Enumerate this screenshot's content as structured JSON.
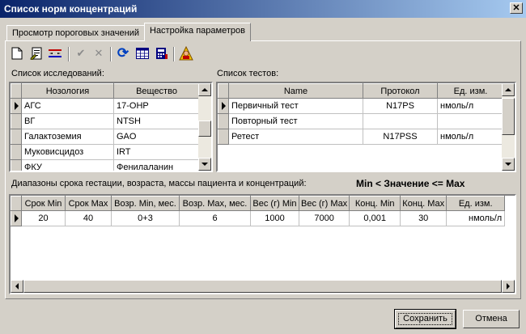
{
  "window": {
    "title": "Список норм концентраций",
    "close_glyph": "✕"
  },
  "tabs": [
    {
      "label": "Просмотр пороговых значений"
    },
    {
      "label": "Настройка параметров"
    }
  ],
  "toolbar": {
    "icons": [
      "new-document-icon",
      "edit-document-icon",
      "move-rows-icon",
      "accept-check-icon",
      "cancel-cross-icon",
      "refresh-icon",
      "grid-table-icon",
      "calculator-icon",
      "user-settings-icon"
    ],
    "check_glyph": "✔",
    "cross_glyph": "✕",
    "refresh_glyph": "⟳"
  },
  "studies": {
    "label": "Список исследований:",
    "columns": [
      "Нозология",
      "Вещество"
    ],
    "rows": [
      [
        "АГС",
        "17-OHP"
      ],
      [
        "ВГ",
        "NTSH"
      ],
      [
        "Галактоземия",
        "GAO"
      ],
      [
        "Муковисцидоз",
        "IRT"
      ],
      [
        "ФКУ",
        "Фенилаланин"
      ]
    ]
  },
  "tests": {
    "label": "Список тестов:",
    "columns": [
      "Name",
      "Протокол",
      "Ед. изм."
    ],
    "rows": [
      [
        "Первичный тест",
        "N17PS",
        "нмоль/л"
      ],
      [
        "Повторный тест",
        "",
        ""
      ],
      [
        "Ретест",
        "N17PSS",
        "нмоль/л"
      ]
    ]
  },
  "ranges": {
    "label": "Диапазоны срока гестации, возраста, массы пациента и концентраций:",
    "formula": "Min < Значение <= Max",
    "columns": [
      "Срок Min",
      "Срок Max",
      "Возр. Min, мес.",
      "Возр. Max, мес.",
      "Вес (г) Min",
      "Вес (г) Max",
      "Конц. Min",
      "Конц. Max",
      "Ед. изм."
    ],
    "rows": [
      [
        "20",
        "40",
        "0+3",
        "6",
        "1000",
        "7000",
        "0,001",
        "30",
        "нмоль/л"
      ]
    ]
  },
  "buttons": {
    "save": "Сохранить",
    "cancel": "Отмена"
  }
}
